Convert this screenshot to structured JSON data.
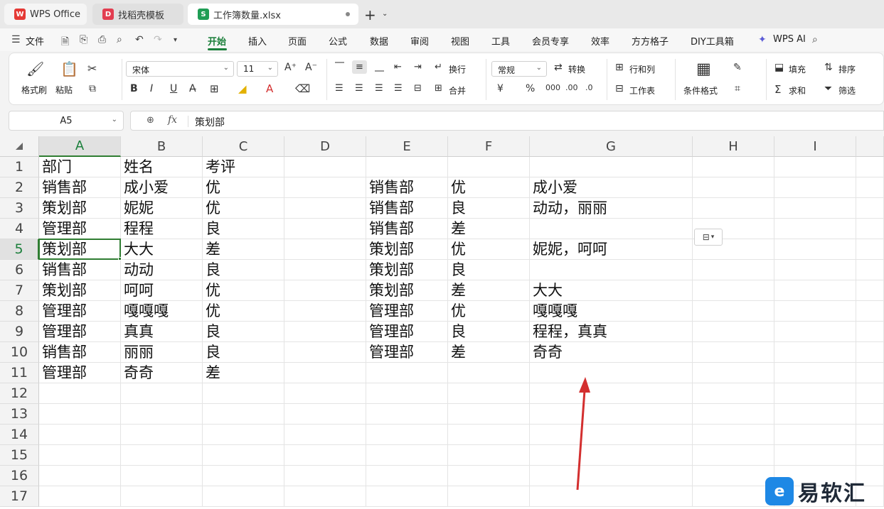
{
  "tabs": [
    {
      "label": "WPS Office",
      "logo": "W"
    },
    {
      "label": "找稻壳模板",
      "logo": "D"
    },
    {
      "label": "工作簿数量.xlsx",
      "logo": "S"
    }
  ],
  "menu": {
    "file": "文件",
    "items": [
      "开始",
      "插入",
      "页面",
      "公式",
      "数据",
      "审阅",
      "视图",
      "工具",
      "会员专享",
      "效率",
      "方方格子",
      "DIY工具箱"
    ],
    "active": "开始",
    "wps_ai": "WPS AI"
  },
  "ribbon": {
    "format_painter": "格式刷",
    "paste": "粘贴",
    "font_name": "宋体",
    "font_size": "11",
    "wrap": "换行",
    "merge": "合并",
    "number_format": "常规",
    "convert": "转换",
    "row_col": "行和列",
    "worksheet": "工作表",
    "cond_format": "条件格式",
    "fill": "填充",
    "sort": "排序",
    "sum": "求和",
    "filter": "筛选"
  },
  "formula": {
    "name_box": "A5",
    "fx": "fx",
    "content": "策划部"
  },
  "columns": [
    "A",
    "B",
    "C",
    "D",
    "E",
    "F",
    "G",
    "H",
    "I"
  ],
  "rows": [
    "1",
    "2",
    "3",
    "4",
    "5",
    "6",
    "7",
    "8",
    "9",
    "10",
    "11",
    "12",
    "13",
    "14",
    "15",
    "16",
    "17"
  ],
  "cells": {
    "A": [
      "部门",
      "销售部",
      "策划部",
      "管理部",
      "策划部",
      "销售部",
      "策划部",
      "管理部",
      "管理部",
      "销售部",
      "管理部"
    ],
    "B": [
      "姓名",
      "成小爱",
      "妮妮",
      "程程",
      "大大",
      "动动",
      "呵呵",
      "嘎嘎嘎",
      "真真",
      "丽丽",
      "奇奇"
    ],
    "C": [
      "考评",
      "优",
      "优",
      "良",
      "差",
      "良",
      "优",
      "优",
      "良",
      "良",
      "差"
    ],
    "E": [
      "",
      "销售部",
      "销售部",
      "销售部",
      "策划部",
      "策划部",
      "策划部",
      "管理部",
      "管理部",
      "管理部",
      ""
    ],
    "F": [
      "",
      "优",
      "良",
      "差",
      "优",
      "良",
      "差",
      "优",
      "良",
      "差",
      ""
    ],
    "G": [
      "",
      "成小爱",
      "动动，丽丽",
      "",
      "妮妮，呵呵",
      "",
      "大大",
      "嘎嘎嘎",
      "程程，真真",
      "奇奇",
      ""
    ]
  },
  "active": {
    "col": "A",
    "row": "5"
  },
  "watermark": "易软汇",
  "colors": {
    "accent": "#1b7f3b",
    "arrow": "#d32f2f"
  }
}
